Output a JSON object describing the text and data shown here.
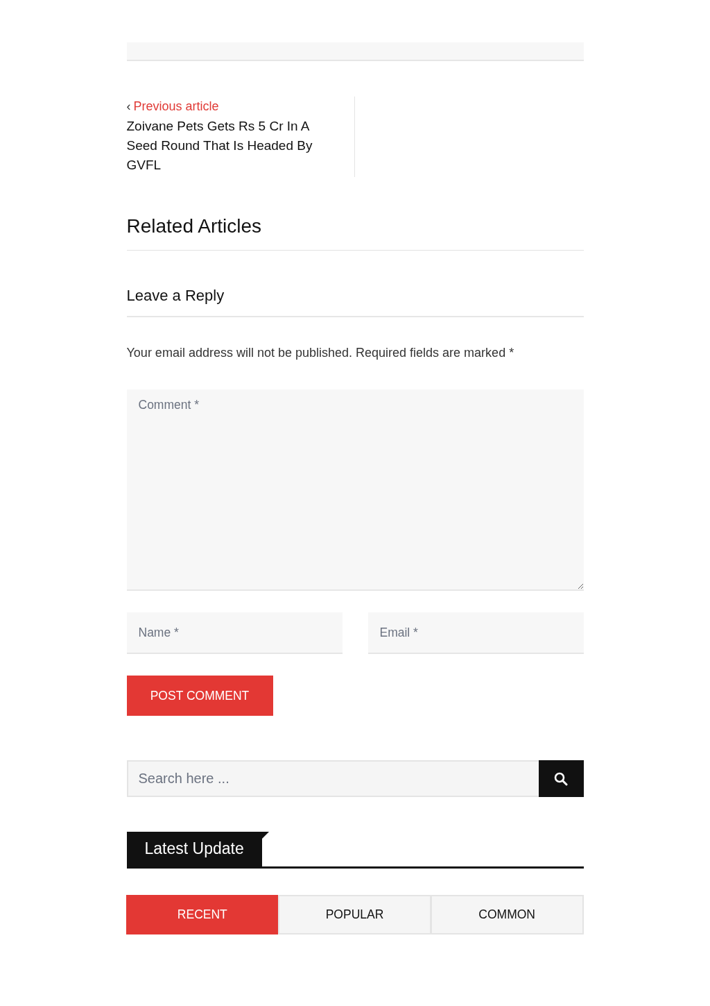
{
  "previous_article": {
    "label": "Previous article",
    "arrow": "‹",
    "title": "Zoivane Pets Gets Rs 5 Cr In A Seed Round That Is Headed By GVFL"
  },
  "related": {
    "heading": "Related Articles"
  },
  "reply": {
    "heading": "Leave a Reply",
    "note": "Your email address will not be published. Required fields are marked *",
    "comment": {
      "placeholder": "Comment *"
    },
    "name": {
      "placeholder": "Name *"
    },
    "email": {
      "placeholder": "Email *"
    },
    "submit": "POST COMMENT"
  },
  "search": {
    "placeholder": "Search here ..."
  },
  "widget": {
    "title": "Latest Update",
    "tabs": [
      {
        "label": "RECENT",
        "selected": true
      },
      {
        "label": "POPULAR",
        "selected": false
      },
      {
        "label": "COMMON",
        "selected": false
      }
    ]
  }
}
